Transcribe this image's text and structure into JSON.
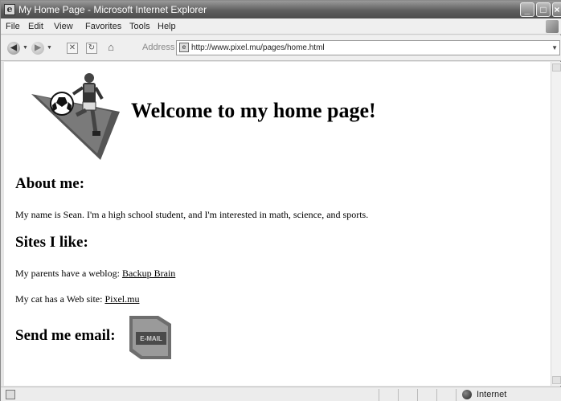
{
  "window": {
    "title": "My Home Page - Microsoft Internet Explorer"
  },
  "menu": [
    "File",
    "Edit",
    "View",
    "Favorites",
    "Tools",
    "Help"
  ],
  "toolbar": {
    "address_label": "Address",
    "url": "http://www.pixel.mu/pages/home.html"
  },
  "page": {
    "welcome": "Welcome to my home page!",
    "about_heading": "About me:",
    "about_text": "My name is Sean. I'm a high school student, and I'm interested in math, science, and sports.",
    "sites_heading": "Sites I like:",
    "blog_prefix": "My parents have a weblog:",
    "blog_link": "Backup Brain",
    "cat_prefix": "My cat has a Web site:",
    "cat_link": "Pixel.mu",
    "email_heading": "Send me email:",
    "email_button_label": "E-MAIL"
  },
  "status": {
    "zone": "Internet"
  },
  "icons": [
    "app-icon",
    "back-icon",
    "forward-icon",
    "stop-icon",
    "refresh-icon",
    "home-icon",
    "page-icon",
    "status-page-icon",
    "internet-zone-icon",
    "minimize-icon",
    "maximize-icon",
    "close-icon"
  ]
}
